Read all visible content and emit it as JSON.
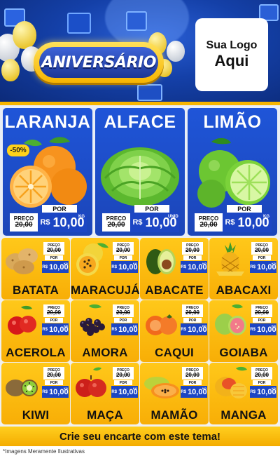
{
  "header": {
    "banner_text": "ANIVERSÁRIO",
    "logo_line1": "Sua Logo",
    "logo_line2": "Aqui"
  },
  "featured": [
    {
      "name": "LARANJA",
      "discount": "-50%",
      "preco_label": "PREÇO",
      "old_price": "20,00",
      "old_currency": "R$",
      "por_label": "POR",
      "currency": "R$",
      "price": "10,00",
      "unit": "KG",
      "icon": "orange-icon"
    },
    {
      "name": "ALFACE",
      "preco_label": "PREÇO",
      "old_price": "20,00",
      "old_currency": "R$",
      "por_label": "POR",
      "currency": "R$",
      "price": "10,00",
      "unit": "UNID",
      "icon": "lettuce-icon"
    },
    {
      "name": "LIMÃO",
      "preco_label": "PREÇO",
      "old_price": "20,00",
      "old_currency": "R$",
      "por_label": "POR",
      "currency": "R$",
      "price": "10,00",
      "unit": "KG",
      "icon": "lime-icon"
    }
  ],
  "products": [
    {
      "name": "BATATA",
      "icon": "potato-icon"
    },
    {
      "name": "MARACUJÁ",
      "icon": "passion-fruit-icon"
    },
    {
      "name": "ABACATE",
      "icon": "avocado-icon"
    },
    {
      "name": "ABACAXI",
      "icon": "pineapple-icon"
    },
    {
      "name": "ACEROLA",
      "icon": "acerola-icon"
    },
    {
      "name": "AMORA",
      "icon": "blackberry-icon"
    },
    {
      "name": "CAQUI",
      "icon": "persimmon-icon"
    },
    {
      "name": "GOIABA",
      "icon": "guava-icon"
    },
    {
      "name": "KIWI",
      "icon": "kiwi-icon"
    },
    {
      "name": "MAÇA",
      "icon": "apple-icon"
    },
    {
      "name": "MAMÃO",
      "icon": "papaya-icon"
    },
    {
      "name": "MANGA",
      "icon": "mango-icon"
    }
  ],
  "product_price": {
    "preco_label": "PREÇO",
    "old_price": "20,00",
    "old_currency": "R$",
    "por_label": "POR",
    "currency": "R$",
    "price": "10,00",
    "unit": "KG"
  },
  "footer": {
    "cta": "Crie seu encarte com este tema!",
    "disclaimer": "*Imagens Meramente Ilustrativas"
  },
  "colors": {
    "header_blue": "#1440a8",
    "card_blue": "#1f55d8",
    "price_blue": "#1c46c4",
    "yellow": "#f8ae06"
  }
}
